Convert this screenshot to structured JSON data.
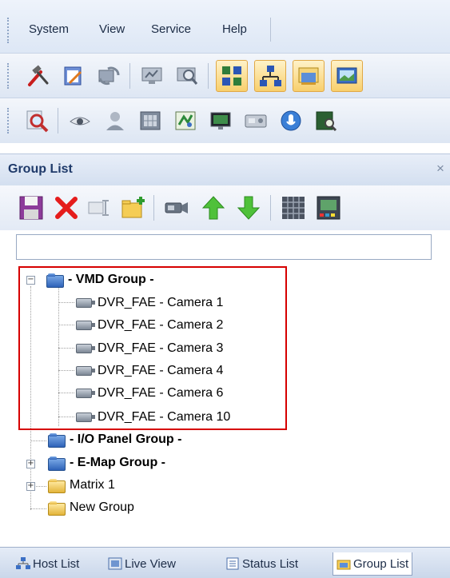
{
  "menu": {
    "items": [
      "System",
      "View",
      "Service",
      "Help"
    ]
  },
  "toolbar1": {
    "icons": [
      "tools-icon",
      "notepad-icon",
      "sync-icon",
      "monitor-icon",
      "search-monitor-icon",
      "network-grid-icon",
      "network-tree-icon",
      "folder-window-icon",
      "screen-icon"
    ]
  },
  "toolbar2": {
    "icons": [
      "magnifier-icon",
      "eye-icon",
      "person-icon",
      "film-grid-icon",
      "map-icon",
      "display-icon",
      "io-box-icon",
      "microphone-icon",
      "map-search-icon"
    ]
  },
  "panel": {
    "title": "Group List",
    "close_glyph": "×"
  },
  "panel_toolbar": {
    "icons": [
      "save-icon",
      "delete-icon",
      "rename-icon",
      "new-folder-icon",
      "camera-icon",
      "move-up-icon",
      "move-down-icon",
      "grid-icon",
      "matrix-icon"
    ]
  },
  "search": {
    "value": ""
  },
  "tree": {
    "vmd_group": {
      "label": "- VMD Group -",
      "cameras": [
        "DVR_FAE - Camera 1",
        "DVR_FAE - Camera 2",
        "DVR_FAE - Camera 3",
        "DVR_FAE - Camera 4",
        "DVR_FAE - Camera 6",
        "DVR_FAE - Camera 10"
      ]
    },
    "io_group": {
      "label": "- I/O Panel Group -"
    },
    "emap_group": {
      "label": "- E-Map Group -"
    },
    "matrix": {
      "label": "Matrix 1"
    },
    "new_group": {
      "label": "New Group"
    }
  },
  "tabs": [
    {
      "label": "Host List",
      "icon": "host-list-icon"
    },
    {
      "label": "Live View",
      "icon": "live-view-icon"
    },
    {
      "label": "Status List",
      "icon": "status-list-icon"
    },
    {
      "label": "Group List",
      "icon": "group-list-icon",
      "active": true
    }
  ],
  "colors": {
    "highlight": "#d60000",
    "folder_blue": "#2e62b8",
    "folder_yellow": "#e3b43a",
    "active_button": "#f8cf6c"
  }
}
